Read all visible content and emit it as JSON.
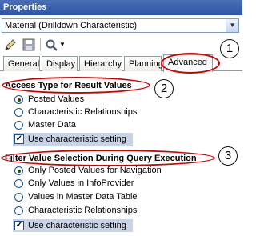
{
  "window": {
    "title": "Properties"
  },
  "object_selector": {
    "value": "Material (Drilldown Characteristic)"
  },
  "toolbar": {
    "icons": [
      "pencil-icon",
      "save-icon",
      "tools-icon",
      "dropdown-arrow-icon"
    ]
  },
  "tabs": [
    {
      "label": "General"
    },
    {
      "label": "Display"
    },
    {
      "label": "Hierarchy"
    },
    {
      "label": "Planning"
    },
    {
      "label": "Advanced"
    }
  ],
  "access_type": {
    "heading": "Access Type for Result Values",
    "options": [
      {
        "label": "Posted Values",
        "selected": true
      },
      {
        "label": "Characteristic Relationships",
        "selected": false
      },
      {
        "label": "Master Data",
        "selected": false
      }
    ],
    "use_setting_label": "Use characteristic setting",
    "use_setting_checked": true
  },
  "filter_selection": {
    "heading": "Filter Value Selection During Query Execution",
    "options": [
      {
        "label": "Only Posted Values for Navigation",
        "selected": true
      },
      {
        "label": "Only Values in InfoProvider",
        "selected": false
      },
      {
        "label": "Values in Master Data Table",
        "selected": false
      },
      {
        "label": "Characteristic Relationships",
        "selected": false
      }
    ],
    "use_setting_label": "Use characteristic setting",
    "use_setting_checked": true
  },
  "callouts": [
    "1",
    "2",
    "3"
  ],
  "colors": {
    "highlight": "#d00000",
    "title_bar": "#3a60ac"
  }
}
